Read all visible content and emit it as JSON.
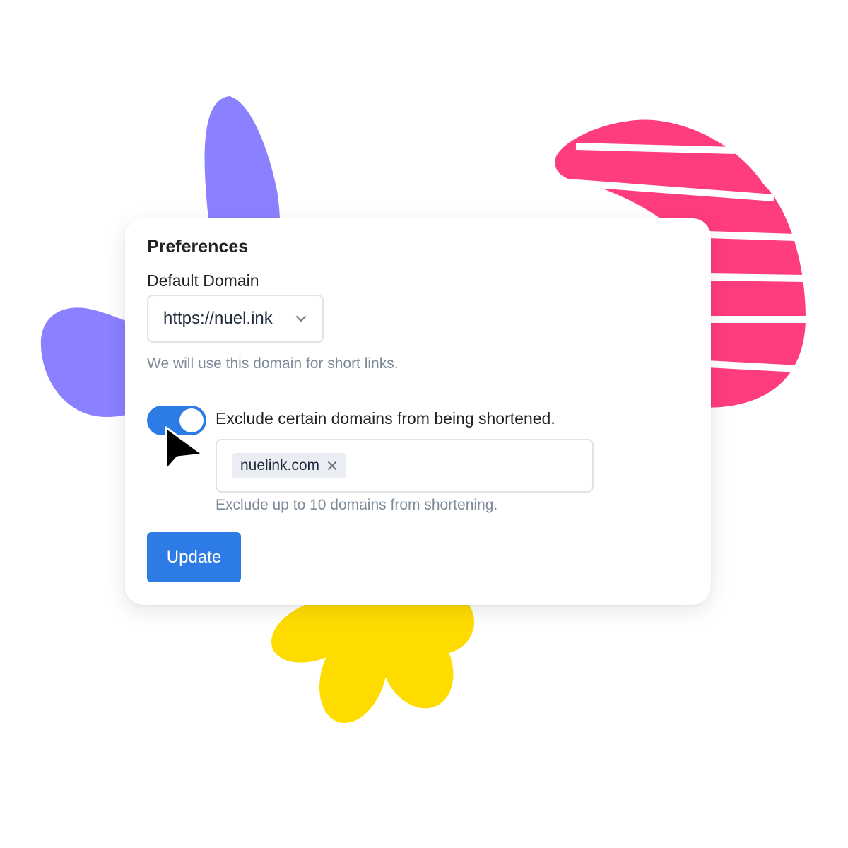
{
  "preferences": {
    "title": "Preferences",
    "default_domain": {
      "label": "Default Domain",
      "selected": "https://nuel.ink",
      "help": "We will use this domain for short links."
    },
    "exclude": {
      "enabled": true,
      "label": "Exclude certain domains from being shortened.",
      "tags": [
        "nuelink.com"
      ],
      "help": "Exclude up to 10 domains from shortening."
    },
    "update_label": "Update"
  },
  "colors": {
    "accent": "#2d7be5",
    "decor_purple": "#8b80ff",
    "decor_pink": "#ff3c7d",
    "decor_yellow": "#ffdc00"
  },
  "icons": {
    "select_chevron": "chevron-down-icon",
    "tag_remove": "close-icon",
    "pointer": "cursor-icon"
  }
}
